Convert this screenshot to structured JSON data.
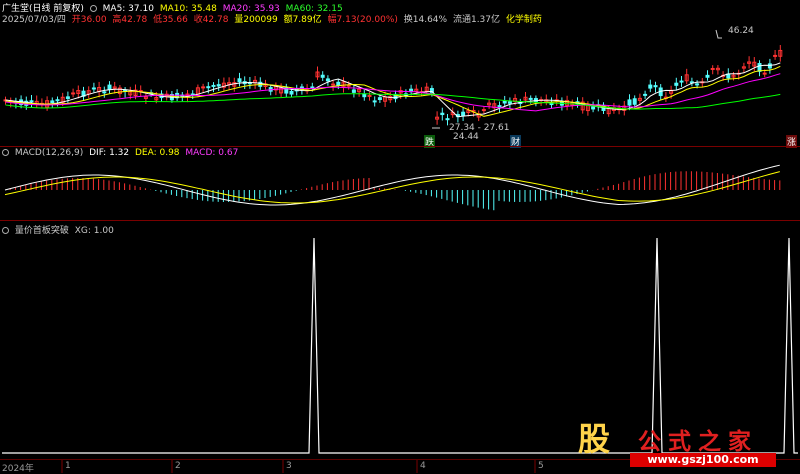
{
  "header": {
    "name": "广生堂(日线 前复权)",
    "ma5": "MA5: 37.10",
    "ma10": "MA10: 35.48",
    "ma20": "MA20: 35.93",
    "ma60": "MA60: 32.15",
    "date": "2025/07/03/四",
    "open": "开36.00",
    "high": "高42.78",
    "low": "低35.66",
    "close": "收42.78",
    "volume": "量200099",
    "amount": "额7.89亿",
    "change": "幅7.13(20.00%)",
    "turnover": "换14.64%",
    "float_cap": "流通1.37亿",
    "industry": "化学制药"
  },
  "annotations": {
    "high_label": "46.24",
    "range_label": "27.34 - 27.61",
    "low_label": "24.44",
    "tag_die": "跌",
    "tag_cai": "财",
    "tag_zhang": "涨"
  },
  "macd_panel": {
    "title": "MACD(12,26,9)",
    "dif": "DIF: 1.32",
    "dea": "DEA: 0.98",
    "macd": "MACD: 0.67"
  },
  "xg_panel": {
    "title": "量价首板突破",
    "xg": "XG: 1.00"
  },
  "xaxis": {
    "year": "2024年",
    "m1": "1",
    "m2": "2",
    "m3": "3",
    "m4": "4",
    "m5": "5"
  },
  "logo": {
    "char": "股",
    "text": "公式之家",
    "url": "www.gszj100.com"
  },
  "colors": {
    "up": "#ff3232",
    "down": "#54fcfc",
    "ma5": "#ffffff",
    "ma10": "#ffff00",
    "ma20": "#ff00ff",
    "ma60": "#00ff00"
  }
}
